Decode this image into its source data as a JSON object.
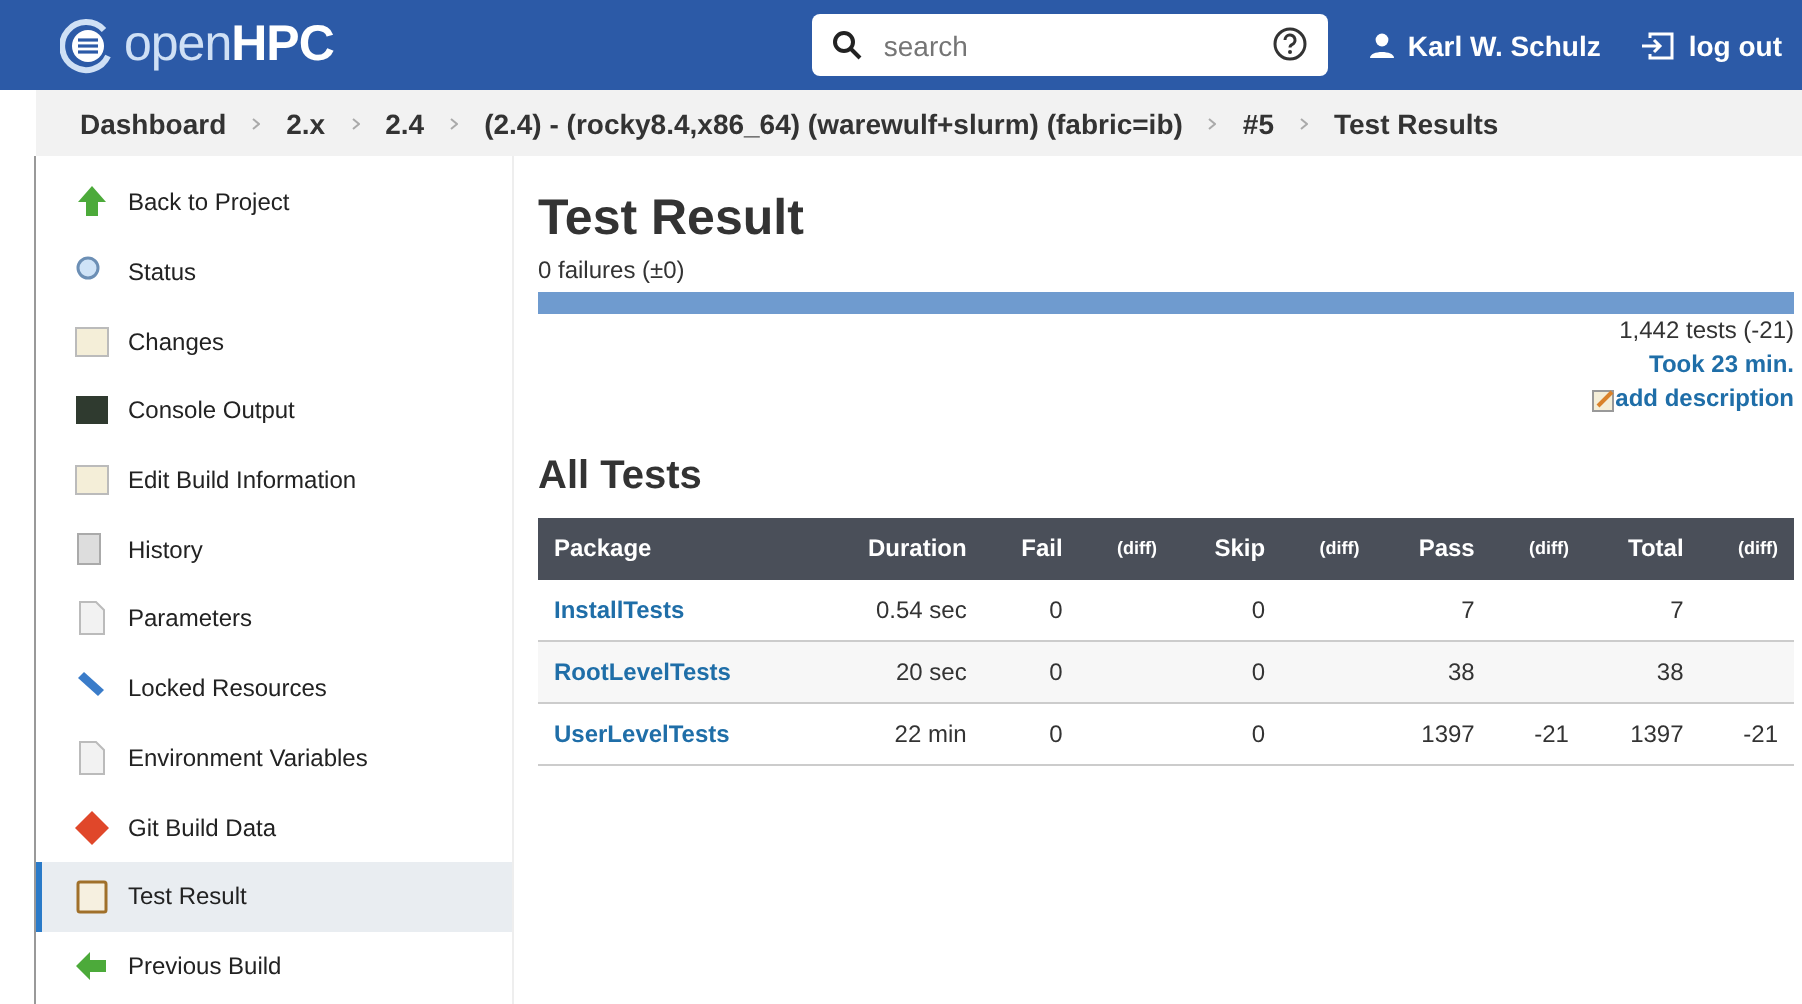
{
  "header": {
    "logo": "open**HPC**",
    "search": {
      "placeholder": "search"
    },
    "user": "Karl W. Schulz",
    "logout": "log out"
  },
  "breadcrumbs": [
    "Dashboard",
    "2.x",
    "2.4",
    "(2.4) - (rocky8.4,x86_64) (warewulf+slurm) (fabric=ib)",
    "#5",
    "Test Results"
  ],
  "sidebar": {
    "items": [
      {
        "label": "Back to Project",
        "selected": false
      },
      {
        "label": "Status",
        "selected": false
      },
      {
        "label": "Changes",
        "selected": false
      },
      {
        "label": "Console Output",
        "selected": false
      },
      {
        "label": "Edit Build Information",
        "selected": false
      },
      {
        "label": "History",
        "selected": false
      },
      {
        "label": "Parameters",
        "selected": false
      },
      {
        "label": "Locked Resources",
        "selected": false
      },
      {
        "label": "Environment Variables",
        "selected": false
      },
      {
        "label": "Git Build Data",
        "selected": false
      },
      {
        "label": "Test Result",
        "selected": true
      },
      {
        "label": "Previous Build",
        "selected": false
      }
    ]
  },
  "main": {
    "title": "Test Result",
    "failures": "0 failures (±0)",
    "progress": {
      "level": 1
    },
    "tests_count": "1,442 tests (-21)",
    "took": "Took 23 min.",
    "add_description": "add description",
    "section_title": "All Tests",
    "table": {
      "columns": [
        "Package",
        "Duration",
        "Fail",
        "(diff)",
        "Skip",
        "(diff)",
        "Pass",
        "(diff)",
        "Total",
        "(diff)"
      ],
      "rows": [
        [
          "InstallTests",
          "0.54 sec",
          "0",
          "",
          "0",
          "",
          "7",
          "",
          "7",
          ""
        ],
        [
          "RootLevelTests",
          "20 sec",
          "0",
          "",
          "0",
          "",
          "38",
          "",
          "38",
          ""
        ],
        [
          "UserLevelTests",
          "22 min",
          "0",
          "",
          "0",
          "",
          "1397",
          "-21",
          "1397",
          "-21"
        ]
      ]
    }
  }
}
